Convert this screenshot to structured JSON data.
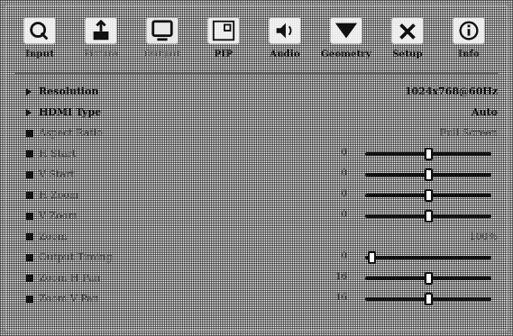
{
  "tabs": [
    {
      "label": "Input"
    },
    {
      "label": "Picture"
    },
    {
      "label": "Output"
    },
    {
      "label": "PIP"
    },
    {
      "label": "Audio"
    },
    {
      "label": "Geometry"
    },
    {
      "label": "Setup"
    },
    {
      "label": "Info"
    }
  ],
  "rows": {
    "resolution": {
      "name": "Resolution",
      "value": "1024x768@60Hz"
    },
    "hdmi_type": {
      "name": "HDMI Type",
      "value": "Auto"
    },
    "aspect_ratio": {
      "name": "Aspect Ratio",
      "value": "Full Screen"
    },
    "h_start": {
      "name": "H Start",
      "number": "0"
    },
    "v_start": {
      "name": "V Start",
      "number": "0"
    },
    "h_zoom": {
      "name": "H Zoom",
      "number": "0"
    },
    "v_zoom": {
      "name": "V Zoom",
      "number": "0"
    },
    "zoom": {
      "name": "Zoom",
      "value": "100%"
    },
    "output_timing": {
      "name": "Output Timing",
      "number": "0"
    },
    "zoom_h_pan": {
      "name": "Zoom H Pan",
      "number": "16"
    },
    "zoom_v_pan": {
      "name": "Zoom V Pan",
      "number": "16"
    }
  },
  "slider_levels": {
    "h_start": 0.5,
    "v_start": 0.5,
    "h_zoom": 0.5,
    "v_zoom": 0.5,
    "output_timing": 0.05,
    "zoom_h_pan": 0.5,
    "zoom_v_pan": 0.5
  },
  "icons": [
    "input-icon",
    "picture-icon",
    "output-icon",
    "pip-icon",
    "audio-icon",
    "geometry-icon",
    "setup-icon",
    "info-icon"
  ]
}
